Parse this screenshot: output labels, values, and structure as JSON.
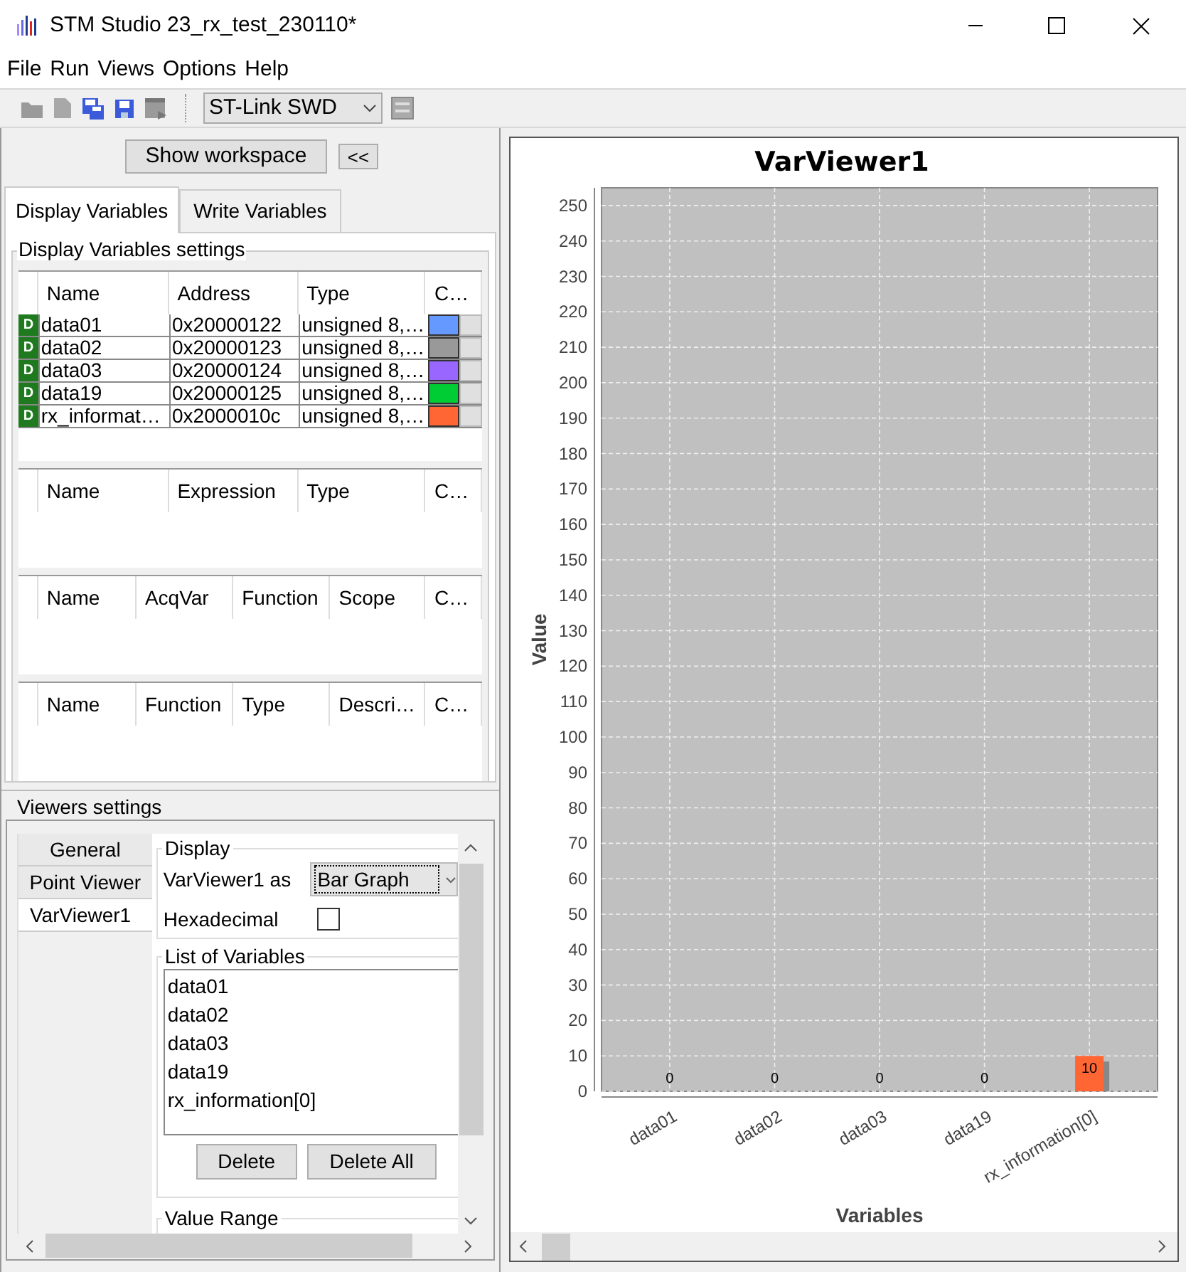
{
  "window": {
    "title": "STM Studio 23_rx_test_230110*"
  },
  "menu": [
    "File",
    "Run",
    "Views",
    "Options",
    "Help"
  ],
  "toolbar": {
    "connection": "ST-Link SWD"
  },
  "workspace_button": "Show workspace",
  "collapse_button": "<<",
  "tabs": [
    {
      "label": "Display Variables",
      "selected": true
    },
    {
      "label": "Write Variables",
      "selected": false
    }
  ],
  "display_settings": {
    "title": "Display Variables settings",
    "tables": [
      {
        "columns": [
          "Name",
          "Address",
          "Type",
          "C…"
        ],
        "rows": [
          {
            "badge": "D",
            "name": "data01",
            "address": "0x20000122",
            "type": "unsigned 8,…",
            "color": "#6699ff"
          },
          {
            "badge": "D",
            "name": "data02",
            "address": "0x20000123",
            "type": "unsigned 8,…",
            "color": "#999999"
          },
          {
            "badge": "D",
            "name": "data03",
            "address": "0x20000124",
            "type": "unsigned 8,…",
            "color": "#9966ff"
          },
          {
            "badge": "D",
            "name": "data19",
            "address": "0x20000125",
            "type": "unsigned 8,…",
            "color": "#00cc33"
          },
          {
            "badge": "D",
            "name": "rx_informat…",
            "address": "0x2000010c",
            "type": "unsigned 8,…",
            "color": "#ff6633"
          }
        ]
      },
      {
        "columns": [
          "Name",
          "Expression",
          "Type",
          "C…"
        ]
      },
      {
        "columns": [
          "Name",
          "AcqVar",
          "Function",
          "Scope",
          "C…"
        ]
      },
      {
        "columns": [
          "Name",
          "Function",
          "Type",
          "Descri…",
          "C…"
        ]
      }
    ]
  },
  "viewers_settings": {
    "title": "Viewers settings",
    "tabs": [
      {
        "label": "General",
        "selected": false
      },
      {
        "label": "Point Viewer",
        "selected": false
      },
      {
        "label": "VarViewer1",
        "selected": true
      }
    ],
    "display": {
      "title": "Display",
      "viewer_label": "VarViewer1 as",
      "viewer_mode": "Bar Graph",
      "hexadecimal_label": "Hexadecimal",
      "hexadecimal": false
    },
    "list_of_variables": {
      "title": "List of Variables",
      "items": [
        "data01",
        "data02",
        "data03",
        "data19",
        "rx_information[0]"
      ]
    },
    "buttons": [
      "Delete",
      "Delete All"
    ],
    "value_range_title": "Value Range"
  },
  "viewer": {
    "chart_data": {
      "type": "bar",
      "title": "VarViewer1",
      "xlabel": "Variables",
      "ylabel": "Value",
      "categories": [
        "data01",
        "data02",
        "data03",
        "data19",
        "rx_information[0]"
      ],
      "series": [
        {
          "color": "#ff6633",
          "values": [
            0,
            0,
            0,
            0,
            10
          ]
        }
      ],
      "grid": true,
      "ylim": [
        0,
        255
      ],
      "yticks": [
        0,
        10,
        20,
        30,
        40,
        50,
        60,
        70,
        80,
        90,
        100,
        110,
        120,
        130,
        140,
        150,
        160,
        170,
        180,
        190,
        200,
        210,
        220,
        230,
        240,
        250
      ],
      "data_labels": true
    }
  }
}
